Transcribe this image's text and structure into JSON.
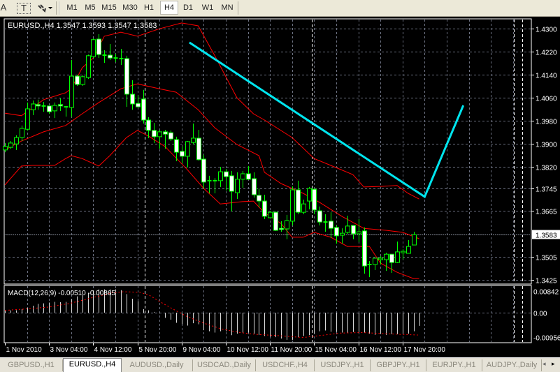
{
  "toolbar": {
    "left_icons": [
      "text-a-icon",
      "text-label-icon",
      "arrows-dropdown-icon"
    ],
    "text_icon_glyph": "A",
    "label_icon_glyph": "T",
    "timeframes": [
      "M1",
      "M5",
      "M15",
      "M30",
      "H1",
      "H4",
      "D1",
      "W1",
      "MN"
    ],
    "active_timeframe": "H4"
  },
  "chart": {
    "header": "EURUSD.,H4  1.3547 1.3593 1.3547 1.3583",
    "price_ticks": [
      "1.4300",
      "1.4220",
      "1.4140",
      "1.4060",
      "1.3980",
      "1.3900",
      "1.3820",
      "1.3745",
      "1.3665",
      "1.3505",
      "1.3425"
    ],
    "current_price": "1.3583",
    "colors": {
      "bull": "#00ff00",
      "bear_body": "#ffffff",
      "bands": "#ff0000",
      "trendline": "#00e5ee",
      "grid": "#6b7080",
      "signal": "#ff0000",
      "histogram": "#d8d8d8"
    }
  },
  "chart_data": [
    {
      "type": "candlestick",
      "title": "EURUSD.,H4",
      "ohlc_fields": [
        "open",
        "high",
        "low",
        "close"
      ],
      "ylim": [
        1.3425,
        1.43
      ],
      "candles": [
        [
          1.3878,
          1.3902,
          1.387,
          1.389
        ],
        [
          1.3887,
          1.3909,
          1.3882,
          1.3902
        ],
        [
          1.3899,
          1.3929,
          1.3878,
          1.3921
        ],
        [
          1.3921,
          1.3963,
          1.3909,
          1.3953
        ],
        [
          1.395,
          1.4043,
          1.3946,
          1.4021
        ],
        [
          1.4018,
          1.405,
          1.3999,
          1.4038
        ],
        [
          1.4036,
          1.4053,
          1.4018,
          1.4031
        ],
        [
          1.4031,
          1.4045,
          1.4011,
          1.4028
        ],
        [
          1.4031,
          1.4031,
          1.4004,
          1.4011
        ],
        [
          1.4014,
          1.4043,
          1.3989,
          1.4033
        ],
        [
          1.4036,
          1.4057,
          1.4014,
          1.4031
        ],
        [
          1.4026,
          1.4031,
          1.3994,
          1.4028
        ],
        [
          1.4026,
          1.4191,
          1.3994,
          1.4135
        ],
        [
          1.4135,
          1.414,
          1.4101,
          1.4106
        ],
        [
          1.4106,
          1.4138,
          1.4101,
          1.4133
        ],
        [
          1.413,
          1.421,
          1.4125,
          1.4206
        ],
        [
          1.4203,
          1.4266,
          1.4198,
          1.4262
        ],
        [
          1.4264,
          1.4281,
          1.4198,
          1.421
        ],
        [
          1.4208,
          1.4225,
          1.4181,
          1.4206
        ],
        [
          1.4208,
          1.4247,
          1.4191,
          1.4198
        ],
        [
          1.4196,
          1.4213,
          1.4184,
          1.4198
        ],
        [
          1.4196,
          1.423,
          1.4174,
          1.4196
        ],
        [
          1.4196,
          1.4206,
          1.4028,
          1.4072
        ],
        [
          1.4072,
          1.4121,
          1.4018,
          1.4038
        ],
        [
          1.404,
          1.4067,
          1.4026,
          1.4028
        ],
        [
          1.4055,
          1.4087,
          1.397,
          1.3982
        ],
        [
          1.3982,
          1.3992,
          1.3919,
          1.3946
        ],
        [
          1.3946,
          1.3972,
          1.3902,
          1.3924
        ],
        [
          1.3924,
          1.3946,
          1.3882,
          1.3941
        ],
        [
          1.3941,
          1.3948,
          1.3882,
          1.3933
        ],
        [
          1.3938,
          1.3946,
          1.3909,
          1.3916
        ],
        [
          1.3914,
          1.3924,
          1.3839,
          1.387
        ],
        [
          1.3873,
          1.389,
          1.3831,
          1.3856
        ],
        [
          1.3856,
          1.3909,
          1.3817,
          1.3907
        ],
        [
          1.3904,
          1.397,
          1.3897,
          1.3919
        ],
        [
          1.3919,
          1.3948,
          1.3841,
          1.3844
        ],
        [
          1.3846,
          1.3861,
          1.3744,
          1.3766
        ],
        [
          1.3771,
          1.3788,
          1.3727,
          1.3768
        ],
        [
          1.3771,
          1.378,
          1.3727,
          1.3771
        ],
        [
          1.3771,
          1.3819,
          1.3749,
          1.3802
        ],
        [
          1.3802,
          1.3812,
          1.3737,
          1.3785
        ],
        [
          1.3788,
          1.3805,
          1.3664,
          1.3734
        ],
        [
          1.3729,
          1.38,
          1.3707,
          1.3776
        ],
        [
          1.3776,
          1.3805,
          1.3746,
          1.3795
        ],
        [
          1.3795,
          1.3822,
          1.3773,
          1.3776
        ],
        [
          1.3778,
          1.38,
          1.3712,
          1.3722
        ],
        [
          1.372,
          1.3744,
          1.3678,
          1.37
        ],
        [
          1.37,
          1.3722,
          1.3637,
          1.3647
        ],
        [
          1.3642,
          1.3664,
          1.3639,
          1.3661
        ],
        [
          1.3661,
          1.3664,
          1.3596,
          1.3598
        ],
        [
          1.3605,
          1.363,
          1.3593,
          1.3601
        ],
        [
          1.3603,
          1.3652,
          1.3567,
          1.3632
        ],
        [
          1.363,
          1.3751,
          1.3615,
          1.3739
        ],
        [
          1.3739,
          1.3771,
          1.3654,
          1.3661
        ],
        [
          1.3661,
          1.3705,
          1.3654,
          1.369
        ],
        [
          1.37,
          1.3749,
          1.3671,
          1.3744
        ],
        [
          1.3741,
          1.3744,
          1.3654,
          1.3669
        ],
        [
          1.3666,
          1.3681,
          1.3615,
          1.3627
        ],
        [
          1.3627,
          1.3654,
          1.3593,
          1.3625
        ],
        [
          1.363,
          1.3661,
          1.3571,
          1.3605
        ],
        [
          1.3608,
          1.3615,
          1.3552,
          1.3579
        ],
        [
          1.3581,
          1.3605,
          1.3552,
          1.3588
        ],
        [
          1.3591,
          1.3649,
          1.3586,
          1.3613
        ],
        [
          1.3615,
          1.3615,
          1.3567,
          1.3586
        ],
        [
          1.3586,
          1.3637,
          1.3557,
          1.3593
        ],
        [
          1.3596,
          1.3608,
          1.3447,
          1.3474
        ],
        [
          1.3479,
          1.3491,
          1.3435,
          1.3477
        ],
        [
          1.3479,
          1.3501,
          1.346,
          1.3501
        ],
        [
          1.3496,
          1.3508,
          1.3479,
          1.3501
        ],
        [
          1.3496,
          1.352,
          1.3457,
          1.3515
        ],
        [
          1.3515,
          1.3515,
          1.345,
          1.3486
        ],
        [
          1.3486,
          1.3559,
          1.3484,
          1.3523
        ],
        [
          1.352,
          1.3532,
          1.3498,
          1.3525
        ],
        [
          1.3518,
          1.3564,
          1.3518,
          1.3542
        ],
        [
          1.3547,
          1.3593,
          1.3547,
          1.3583
        ]
      ],
      "bollinger_upper": [
        [
          0,
          1.4006
        ],
        [
          3,
          1.3997
        ],
        [
          7,
          1.4053
        ],
        [
          11,
          1.4077
        ],
        [
          12,
          1.4091
        ],
        [
          14,
          1.4164
        ],
        [
          16,
          1.4198
        ],
        [
          18,
          1.4274
        ],
        [
          21,
          1.4288
        ],
        [
          24,
          1.4274
        ],
        [
          28,
          1.43
        ],
        [
          32,
          1.432
        ],
        [
          35,
          1.431
        ],
        [
          38,
          1.4206
        ],
        [
          42,
          1.406
        ],
        [
          45,
          1.4004
        ],
        [
          47,
          1.3982
        ],
        [
          52,
          1.3921
        ],
        [
          56,
          1.3848
        ],
        [
          59,
          1.3824
        ],
        [
          63,
          1.3792
        ],
        [
          65,
          1.3749
        ],
        [
          68,
          1.3751
        ],
        [
          71,
          1.3754
        ],
        [
          73,
          1.3727
        ],
        [
          75,
          1.3707
        ]
      ],
      "bollinger_middle": [
        [
          0,
          1.3878
        ],
        [
          3,
          1.3909
        ],
        [
          7,
          1.3941
        ],
        [
          11,
          1.3963
        ],
        [
          14,
          1.4004
        ],
        [
          17,
          1.4043
        ],
        [
          21,
          1.4091
        ],
        [
          24,
          1.4108
        ],
        [
          28,
          1.4091
        ],
        [
          31,
          1.4079
        ],
        [
          35,
          1.4018
        ],
        [
          38,
          1.3955
        ],
        [
          42,
          1.3897
        ],
        [
          46,
          1.3858
        ],
        [
          47,
          1.38
        ],
        [
          50,
          1.3761
        ],
        [
          54,
          1.3727
        ],
        [
          57,
          1.3695
        ],
        [
          61,
          1.3647
        ],
        [
          65,
          1.3605
        ],
        [
          69,
          1.3598
        ],
        [
          72,
          1.3591
        ],
        [
          75,
          1.3569
        ]
      ],
      "bollinger_lower": [
        [
          0,
          1.3756
        ],
        [
          3,
          1.3822
        ],
        [
          5,
          1.3824
        ],
        [
          9,
          1.3824
        ],
        [
          11,
          1.3848
        ],
        [
          12,
          1.3858
        ],
        [
          14,
          1.3848
        ],
        [
          17,
          1.3822
        ],
        [
          19,
          1.3858
        ],
        [
          22,
          1.3921
        ],
        [
          24,
          1.3946
        ],
        [
          26,
          1.3926
        ],
        [
          29,
          1.389
        ],
        [
          33,
          1.381
        ],
        [
          36,
          1.3744
        ],
        [
          39,
          1.369
        ],
        [
          43,
          1.3698
        ],
        [
          45,
          1.37
        ],
        [
          47,
          1.3659
        ],
        [
          50,
          1.3622
        ],
        [
          52,
          1.3574
        ],
        [
          54,
          1.3574
        ],
        [
          56,
          1.3591
        ],
        [
          59,
          1.3574
        ],
        [
          62,
          1.3542
        ],
        [
          66,
          1.3542
        ],
        [
          68,
          1.3484
        ],
        [
          71,
          1.3452
        ],
        [
          74,
          1.343
        ],
        [
          75,
          1.343
        ]
      ],
      "trendline": [
        [
          33.4,
          1.4252
        ],
        [
          76,
          1.3715
        ],
        [
          83,
          1.4033
        ]
      ],
      "x_tick_labels": [
        {
          "index": 0,
          "label": "1 Nov 2010"
        },
        {
          "index": 8,
          "label": "3 Nov 04:00"
        },
        {
          "index": 16,
          "label": "4 Nov 12:00"
        },
        {
          "index": 24,
          "label": "5 Nov 20:00"
        },
        {
          "index": 32,
          "label": "9 Nov 04:00"
        },
        {
          "index": 40,
          "label": "10 Nov 12:00"
        },
        {
          "index": 48,
          "label": "11 Nov 20:00"
        },
        {
          "index": 56,
          "label": "15 Nov 04:00"
        },
        {
          "index": 64,
          "label": "16 Nov 12:00"
        },
        {
          "index": 72,
          "label": "17 Nov 20:00"
        }
      ]
    },
    {
      "type": "bar",
      "title": "MACD(12,26,9) -0.00510 -0.00865",
      "ylim": [
        -0.00956,
        0.00842
      ],
      "y_tick_labels": [
        "0.00842",
        "0.00",
        "-0.00956"
      ],
      "histogram": [
        0.0009,
        0.0009,
        0.0009,
        0.00135,
        0.0018,
        0.0027,
        0.0034,
        0.0036,
        0.0039,
        0.0042,
        0.0041,
        0.0042,
        0.0052,
        0.0063,
        0.0068,
        0.0077,
        0.0086,
        0.009,
        0.009,
        0.009,
        0.009,
        0.0087,
        0.0072,
        0.0054,
        0.0045,
        0.0014,
        0.0009,
        0.0003,
        -0.0003,
        -0.002,
        -0.0027,
        -0.0039,
        -0.0045,
        -0.005,
        -0.0041,
        -0.0045,
        -0.0068,
        -0.0072,
        -0.0077,
        -0.0072,
        -0.0072,
        -0.0087,
        -0.0081,
        -0.0077,
        -0.0077,
        -0.0081,
        -0.0086,
        -0.009,
        -0.0093,
        -0.0095,
        -0.01,
        -0.0105,
        -0.0105,
        -0.0095,
        -0.009,
        -0.0087,
        -0.0081,
        -0.0072,
        -0.0069,
        -0.0074,
        -0.0075,
        -0.0077,
        -0.0077,
        -0.0075,
        -0.0075,
        -0.0077,
        -0.0081,
        -0.0086,
        -0.0081,
        -0.0086,
        -0.0083,
        -0.0083,
        -0.0081,
        -0.0081,
        -0.0072,
        -0.0051
      ],
      "signal": [
        [
          0,
          0.0009
        ],
        [
          4.2,
          0.0015
        ],
        [
          7.6,
          0.0021
        ],
        [
          11.8,
          0.0036
        ],
        [
          16,
          0.0059
        ],
        [
          19.4,
          0.0077
        ],
        [
          21.5,
          0.0081
        ],
        [
          24.4,
          0.0079
        ],
        [
          26.1,
          0.0068
        ],
        [
          28.6,
          0.0036
        ],
        [
          31.2,
          0.0005
        ],
        [
          32.9,
          -0.0014
        ],
        [
          35.8,
          -0.0039
        ],
        [
          39.2,
          -0.0063
        ],
        [
          42.6,
          -0.0077
        ],
        [
          45.5,
          -0.0084
        ],
        [
          48.9,
          -0.0088
        ],
        [
          50.2,
          -0.009
        ],
        [
          54,
          -0.0096
        ],
        [
          56.5,
          -0.009
        ],
        [
          60.7,
          -0.0079
        ],
        [
          64.5,
          -0.0077
        ],
        [
          68.7,
          -0.0081
        ],
        [
          71.6,
          -0.0084
        ],
        [
          74.8,
          -0.00865
        ]
      ]
    }
  ],
  "tabs": [
    {
      "label": "GBPUSD.,H1",
      "active": false
    },
    {
      "label": "EURUSD.,H4",
      "active": true
    },
    {
      "label": "AUDUSD.,Daily",
      "active": false
    },
    {
      "label": "USDCAD.,Daily",
      "active": false
    },
    {
      "label": "USDCHF.,H4",
      "active": false
    },
    {
      "label": "USDJPY.,H1",
      "active": false
    },
    {
      "label": "GBPJPY.,H1",
      "active": false
    },
    {
      "label": "EURJPY.,H1",
      "active": false
    },
    {
      "label": "AUDJPY.,Daily",
      "active": false
    }
  ],
  "tab_scroll": {
    "left": "◂",
    "right": "▸"
  }
}
